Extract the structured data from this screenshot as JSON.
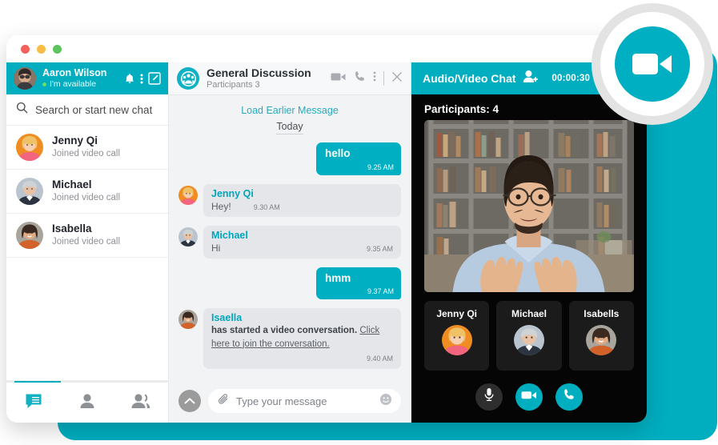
{
  "colors": {
    "accent": "#01AEC0",
    "bubble_out": "#00AFC2",
    "panel_dark": "#050505",
    "link": "#2aa9bd"
  },
  "window": {
    "traffic_lights": [
      "close",
      "minimize",
      "maximize"
    ]
  },
  "sidebar": {
    "user": {
      "name": "Aaron Wilson",
      "status": "I'm available",
      "avatar": "aaron-avatar"
    },
    "header_icons": [
      "bell-icon",
      "more-vertical-icon",
      "compose-icon"
    ],
    "search": {
      "placeholder": "Search or start new chat",
      "icon": "search-icon"
    },
    "contacts": [
      {
        "name": "Jenny Qi",
        "subtitle": "Joined video call",
        "avatar": "jenny-avatar"
      },
      {
        "name": "Michael",
        "subtitle": "Joined video call",
        "avatar": "michael-avatar"
      },
      {
        "name": "Isabella",
        "subtitle": "Joined video call",
        "avatar": "isabella-avatar"
      }
    ],
    "tabs": [
      {
        "name": "chats",
        "icon": "chat-icon",
        "active": true
      },
      {
        "name": "contacts",
        "icon": "person-icon",
        "active": false
      },
      {
        "name": "groups",
        "icon": "people-icon",
        "active": false
      }
    ]
  },
  "chat": {
    "title": "General Discussion",
    "participants": "Participants 3",
    "group_icon": "group-icon",
    "actions": [
      "video-icon",
      "phone-icon",
      "more-vertical-icon",
      "close-icon"
    ],
    "load_earlier": "Load Earlier Message",
    "date_divider": "Today",
    "messages": [
      {
        "side": "out",
        "text": "hello",
        "time": "9.25 AM"
      },
      {
        "side": "in",
        "name": "Jenny Qi",
        "text": "Hey!",
        "time": "9.30 AM",
        "avatar": "jenny-avatar"
      },
      {
        "side": "in",
        "name": "Michael",
        "text": "Hi",
        "time": "9.35 AM",
        "avatar": "michael-avatar"
      },
      {
        "side": "out",
        "text": "hmm",
        "time": "9.37 AM"
      },
      {
        "side": "in",
        "name": "Isaella",
        "text": "has started a video conversation.",
        "link": "Click here to join the conversation.",
        "time": "9.40 AM",
        "avatar": "isabella-avatar"
      }
    ],
    "composer": {
      "placeholder": "Type your message",
      "attach_icon": "paperclip-icon",
      "emoji_icon": "smiley-icon",
      "up_icon": "chevron-up-icon"
    }
  },
  "call": {
    "title": "Audio/Video Chat",
    "add_icon": "add-person-icon",
    "timer": "00:00:30",
    "participants_count": "Participants: 4",
    "main_speaker": "main-video-feed",
    "thumbnails": [
      {
        "name": "Jenny Qi",
        "avatar": "jenny-avatar"
      },
      {
        "name": "Michael",
        "avatar": "michael-avatar"
      },
      {
        "name": "Isabells",
        "avatar": "isabella-avatar"
      }
    ],
    "controls": [
      {
        "name": "mute-mic-button",
        "icon": "microphone-icon",
        "style": "dark"
      },
      {
        "name": "toggle-video-button",
        "icon": "video-icon",
        "style": "teal"
      },
      {
        "name": "end-call-button",
        "icon": "phone-icon",
        "style": "teal"
      }
    ]
  },
  "badge": {
    "icon": "video-camera-icon"
  }
}
